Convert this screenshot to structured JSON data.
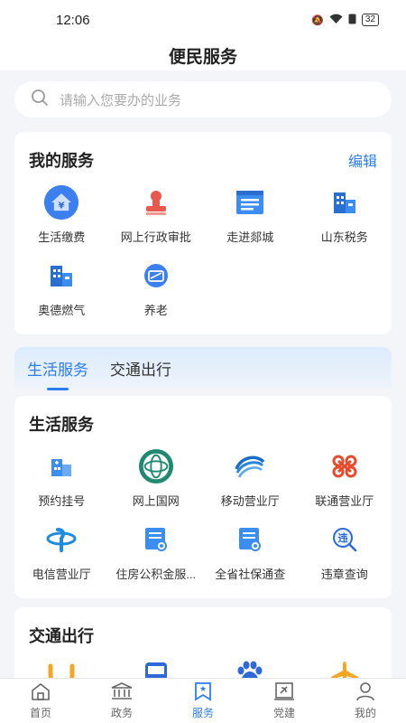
{
  "status_bar": {
    "time": "12:06",
    "battery": "32"
  },
  "header": {
    "title": "便民服务"
  },
  "search": {
    "placeholder": "请输入您要办的业务"
  },
  "my_services": {
    "title": "我的服务",
    "edit_label": "编辑",
    "items": [
      {
        "label": "生活缴费",
        "icon": "yuan-house-icon"
      },
      {
        "label": "网上行政审批",
        "icon": "stamp-icon"
      },
      {
        "label": "走进郯城",
        "icon": "document-icon"
      },
      {
        "label": "山东税务",
        "icon": "building-icon"
      },
      {
        "label": "奥德燃气",
        "icon": "building-icon"
      },
      {
        "label": "养老",
        "icon": "card-icon"
      }
    ]
  },
  "tabs": [
    {
      "label": "生活服务",
      "active": true
    },
    {
      "label": "交通出行",
      "active": false
    }
  ],
  "life_services": {
    "title": "生活服务",
    "items": [
      {
        "label": "预约挂号",
        "icon": "hospital-icon"
      },
      {
        "label": "网上国网",
        "icon": "state-grid-logo"
      },
      {
        "label": "移动营业厅",
        "icon": "china-mobile-logo"
      },
      {
        "label": "联通营业厅",
        "icon": "china-unicom-logo"
      },
      {
        "label": "电信营业厅",
        "icon": "china-telecom-logo"
      },
      {
        "label": "住房公积金服...",
        "icon": "certificate-icon"
      },
      {
        "label": "全省社保通查",
        "icon": "certificate-icon"
      },
      {
        "label": "违章查询",
        "icon": "violation-search-icon"
      }
    ]
  },
  "traffic": {
    "title": "交通出行",
    "items": [
      {
        "icon": "didi-logo"
      },
      {
        "icon": "bus-icon"
      },
      {
        "icon": "baidu-logo"
      },
      {
        "icon": "airplane-icon"
      }
    ]
  },
  "bottom_nav": [
    {
      "label": "首页",
      "icon": "home-icon"
    },
    {
      "label": "政务",
      "icon": "government-icon"
    },
    {
      "label": "服务",
      "icon": "service-icon",
      "active": true
    },
    {
      "label": "党建",
      "icon": "party-building-icon"
    },
    {
      "label": "我的",
      "icon": "profile-icon"
    }
  ],
  "colors": {
    "accent": "#2d7df0",
    "background": "#f3f5f8"
  }
}
